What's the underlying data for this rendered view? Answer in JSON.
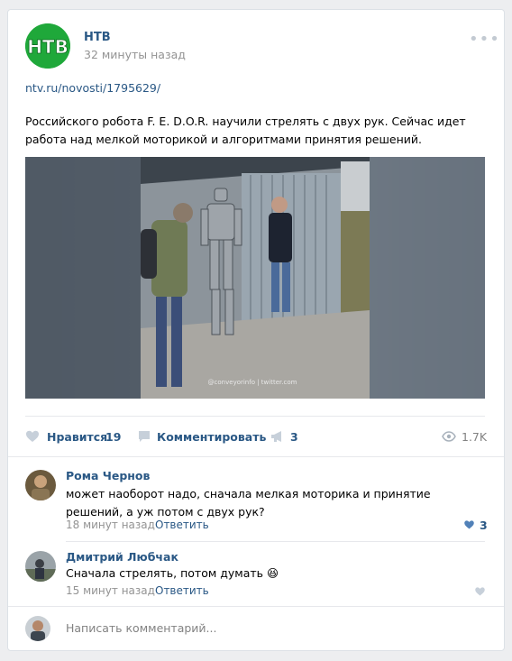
{
  "post": {
    "author": "НТВ",
    "time": "32 минуты назад",
    "link": "ntv.ru/novosti/1795629/",
    "text": "Российского робота F. E. D.O.R. научили стрелять с двух рук. Сейчас идет работа над мелкой моторикой и алгоритмами принятия решений.",
    "photo_watermark": "@conveyorinfo | twitter.com"
  },
  "actions": {
    "like_label": "Нравится",
    "like_count": "19",
    "comment_label": "Комментировать",
    "share_count": "3",
    "views": "1.7K"
  },
  "comments": [
    {
      "author": "Рома Чернов",
      "text": "может наоборот надо, сначала мелкая моторика и принятие решений, а уж потом с двух рук?",
      "time": "18 минут назад",
      "reply": "Ответить",
      "likes": "3"
    },
    {
      "author": "Дмитрий Любчак",
      "text": "Сначала стрелять, потом думать",
      "emoji": "😆",
      "time": "15 минут назад",
      "reply": "Ответить"
    }
  ],
  "composer": {
    "placeholder": "Написать комментарий..."
  },
  "colors": {
    "link": "#2a5885",
    "muted": "#939393",
    "ntv_green": "#1fa83a"
  }
}
